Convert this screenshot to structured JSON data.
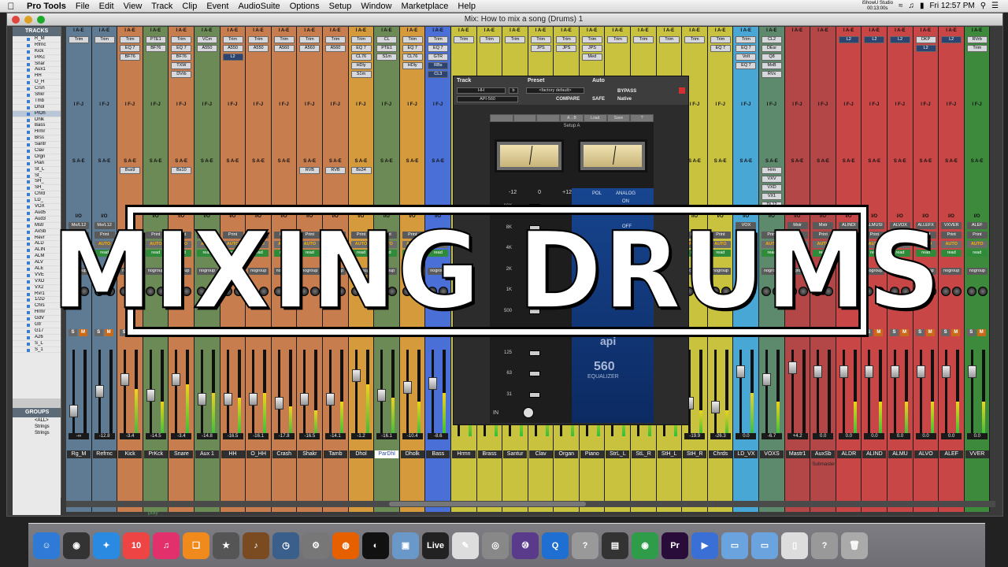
{
  "menubar": {
    "apple": "",
    "items": [
      "Pro Tools",
      "File",
      "Edit",
      "View",
      "Track",
      "Clip",
      "Event",
      "AudioSuite",
      "Options",
      "Setup",
      "Window",
      "Marketplace",
      "Help"
    ],
    "studio_line1": "iShowU Studio",
    "studio_line2": "00:13:00s",
    "clock": "Fri 12:57 PM"
  },
  "window": {
    "title": "Mix: How to mix a song (Drums) 1"
  },
  "leftpanel": {
    "tracks_header": "TRACKS",
    "tracks": [
      "R_M",
      "Rfrnc",
      "Kick",
      "PrKc",
      "Snar",
      "Aux1",
      "HH",
      "O_H",
      "Crsh",
      "Shkr",
      "Tmb",
      "Dhol",
      "PrDh",
      "Dhlk",
      "Bass",
      "Hrmr",
      "Brss",
      "Santr",
      "Clav",
      "Orgn",
      "Pian",
      "St_L",
      "St_",
      "SH_",
      "SH_",
      "Chrd",
      "LD_",
      "VOX",
      "Aud5",
      "Aud3",
      "Mstr",
      "AxSb",
      "Revr",
      "ALD",
      "ALIN",
      "ALM",
      "ALV",
      "ALE",
      "VVE",
      "VXD",
      "VX2",
      "Rvr1",
      "1/2D",
      "Chrs",
      "Hrmr",
      "GdV",
      "Gtr",
      "G17",
      "A26",
      "S_L",
      "S_1"
    ],
    "groups_header": "GROUPS",
    "groups": [
      "<ALL>",
      "Strings",
      "Strings"
    ]
  },
  "strips": [
    {
      "name": "Rg_M",
      "color": "#5f7b93",
      "vol": "-∞",
      "plugs": [
        "Trim"
      ],
      "io": "Mo/L12",
      "sends": [],
      "fader": 0.3,
      "meter": 0.0
    },
    {
      "name": "Refrnc",
      "color": "#5f7b93",
      "vol": "-12.8",
      "plugs": [
        "Trim"
      ],
      "io": "Mo/L12",
      "sends": [],
      "fader": 0.55,
      "meter": 0.0
    },
    {
      "name": "Kick",
      "color": "#c87d4f",
      "vol": "-3.4",
      "plugs": [
        "Trim",
        "EQ 7",
        "BF76"
      ],
      "io": "",
      "sends": [
        "Bus9"
      ],
      "fader": 0.7,
      "meter": 0.55
    },
    {
      "name": "PrKck",
      "color": "#6b8a55",
      "vol": "-14.5",
      "plugs": [
        "PTE1",
        "BF76"
      ],
      "io": "",
      "sends": [],
      "fader": 0.5,
      "meter": 0.4
    },
    {
      "name": "Snare",
      "color": "#c87d4f",
      "vol": "-3.4",
      "plugs": [
        "Trim",
        "EQ 7",
        "BF76",
        "TXW",
        "DVrb"
      ],
      "io": "",
      "sends": [
        "Bs10"
      ],
      "fader": 0.7,
      "meter": 0.6
    },
    {
      "name": "Aux 1",
      "color": "#6b8a55",
      "vol": "-14.8",
      "plugs": [
        "VCm",
        "A550"
      ],
      "io": "",
      "sends": [],
      "fader": 0.45,
      "meter": 0.5
    },
    {
      "name": "HH",
      "color": "#c87d4f",
      "vol": "-16.5",
      "plugs": [
        "Trim",
        "A550",
        "L2"
      ],
      "io": "",
      "sends": [],
      "fader": 0.45,
      "meter": 0.45
    },
    {
      "name": "O_HH",
      "color": "#c87d4f",
      "vol": "-16.1",
      "plugs": [
        "Trim",
        "A550"
      ],
      "io": "",
      "sends": [],
      "fader": 0.45,
      "meter": 0.5
    },
    {
      "name": "Crash",
      "color": "#c87d4f",
      "vol": "-17.8",
      "plugs": [
        "Trim",
        "A560"
      ],
      "io": "",
      "sends": [],
      "fader": 0.4,
      "meter": 0.35
    },
    {
      "name": "Shakr",
      "color": "#c87d4f",
      "vol": "-16.5",
      "plugs": [
        "Trim",
        "A560"
      ],
      "io": "",
      "sends": [
        "RVB"
      ],
      "fader": 0.45,
      "meter": 0.3
    },
    {
      "name": "Tamb",
      "color": "#c87d4f",
      "vol": "-14.1",
      "plugs": [
        "Trim",
        "A560"
      ],
      "io": "",
      "sends": [
        "RVB"
      ],
      "fader": 0.45,
      "meter": 0.4
    },
    {
      "name": "Dhol",
      "color": "#d49a3c",
      "vol": "-1.2",
      "plugs": [
        "Trim",
        "EQ 7",
        "CL76",
        "HDly",
        "S1m"
      ],
      "io": "",
      "sends": [
        "Bs34"
      ],
      "fader": 0.75,
      "meter": 0.6
    },
    {
      "name": "ParDhl",
      "color": "#6b8a55",
      "vol": "-16.1",
      "plugs": [
        "CL",
        "PTE1",
        "S1m"
      ],
      "io": "",
      "sends": [],
      "fader": 0.5,
      "meter": 0.45,
      "selected": true
    },
    {
      "name": "Dholk",
      "color": "#d49a3c",
      "vol": "-10.4",
      "plugs": [
        "Trim",
        "EQ 7",
        "CL76",
        "HDly"
      ],
      "io": "",
      "sends": [],
      "fader": 0.6,
      "meter": 0.4
    },
    {
      "name": "Bass",
      "color": "#4a6fd6",
      "vol": "-8.6",
      "plugs": [
        "Trim",
        "EQ 7",
        "GTR",
        "RBs",
        "CL3"
      ],
      "io": "",
      "sends": [],
      "fader": 0.65,
      "meter": 0.5
    },
    {
      "name": "Hrmn",
      "color": "#c9c23f",
      "vol": "",
      "plugs": [
        "Trim"
      ],
      "io": "",
      "sends": [],
      "fader": 0.5,
      "meter": 0.3
    },
    {
      "name": "Brass",
      "color": "#c9c23f",
      "vol": "",
      "plugs": [
        "Trim"
      ],
      "io": "",
      "sends": [],
      "fader": 0.5,
      "meter": 0.3
    },
    {
      "name": "Santur",
      "color": "#c9c23f",
      "vol": "",
      "plugs": [
        "Trim"
      ],
      "io": "",
      "sends": [],
      "fader": 0.5,
      "meter": 0.3
    },
    {
      "name": "Clav",
      "color": "#c9c23f",
      "vol": "",
      "plugs": [
        "Trim",
        "JPS"
      ],
      "io": "",
      "sends": [],
      "fader": 0.5,
      "meter": 0.3
    },
    {
      "name": "Organ",
      "color": "#c9c23f",
      "vol": "",
      "plugs": [
        "Trim",
        "JPS"
      ],
      "io": "",
      "sends": [],
      "fader": 0.5,
      "meter": 0.3
    },
    {
      "name": "Piano",
      "color": "#c9c23f",
      "vol": "",
      "plugs": [
        "Trim",
        "JPS",
        "Med"
      ],
      "io": "",
      "sends": [],
      "fader": 0.5,
      "meter": 0.3
    },
    {
      "name": "StrL_L",
      "color": "#c9c23f",
      "vol": "",
      "plugs": [
        "Trim"
      ],
      "io": "",
      "sends": [],
      "fader": 0.5,
      "meter": 0.3
    },
    {
      "name": "StL_R",
      "color": "#c9c23f",
      "vol": "",
      "plugs": [
        "Trim"
      ],
      "io": "",
      "sends": [],
      "fader": 0.5,
      "meter": 0.3
    },
    {
      "name": "StH_L",
      "color": "#c9c23f",
      "vol": "",
      "plugs": [
        "Trim"
      ],
      "io": "",
      "sends": [],
      "fader": 0.5,
      "meter": 0.3
    },
    {
      "name": "StH_R",
      "color": "#c9c23f",
      "vol": "-19.9",
      "plugs": [
        "Trim"
      ],
      "io": "",
      "sends": [],
      "fader": 0.4,
      "meter": 0.3
    },
    {
      "name": "Chrds",
      "color": "#c9c23f",
      "vol": "-26.3",
      "plugs": [
        "Trim",
        "EQ 7"
      ],
      "io": "",
      "sends": [],
      "fader": 0.35,
      "meter": 0.3
    },
    {
      "name": "LD_VX",
      "color": "#49a7d6",
      "vol": "0.0",
      "plugs": [
        "Trim",
        "EQ 7",
        "VoIt",
        "EQ 7"
      ],
      "io": "VOX",
      "sends": [],
      "fader": 0.8,
      "meter": 0.5
    },
    {
      "name": "VOXS",
      "color": "#5d8a6c",
      "vol": "-6.7",
      "plugs": [
        "CL2",
        "DEsr",
        "Q8",
        "MxB",
        "RVx"
      ],
      "io": "",
      "sends": [
        "Hrm",
        "VXV",
        "VXD",
        "VX1",
        "DL12"
      ],
      "fader": 0.7,
      "meter": 0.4
    },
    {
      "name": "Mastr1",
      "color": "#b34747",
      "vol": "+4.2",
      "plugs": [],
      "io": "Mstr",
      "sends": [],
      "fader": 0.85,
      "meter": 0.0
    },
    {
      "name": "AuxSb",
      "color": "#b34747",
      "vol": "0.0",
      "plugs": [],
      "io": "Mstr",
      "sends": [],
      "fader": 0.8,
      "meter": 0.0,
      "comment": "Submaster"
    },
    {
      "name": "ALDR",
      "color": "#c94646",
      "vol": "0.0",
      "plugs": [
        "L2"
      ],
      "io": "ALINDI",
      "sends": [],
      "fader": 0.8,
      "meter": 0.4
    },
    {
      "name": "ALIND",
      "color": "#c94646",
      "vol": "0.0",
      "plugs": [
        "L2"
      ],
      "io": "ALMUSI",
      "sends": [],
      "fader": 0.8,
      "meter": 0.4
    },
    {
      "name": "ALMU",
      "color": "#c94646",
      "vol": "0.0",
      "plugs": [
        "L2"
      ],
      "io": "ALVOX",
      "sends": [],
      "fader": 0.8,
      "meter": 0.4
    },
    {
      "name": "ALVO",
      "color": "#c94646",
      "vol": "0.0",
      "plugs": [
        "DKP",
        "L2"
      ],
      "io": "ALLEFX",
      "sends": [],
      "fader": 0.8,
      "meter": 0.4
    },
    {
      "name": "ALEF",
      "color": "#c94646",
      "vol": "0.0",
      "plugs": [
        "L2"
      ],
      "io": "VXVER",
      "sends": [],
      "fader": 0.8,
      "meter": 0.4
    },
    {
      "name": "VVER",
      "color": "#3d8a3d",
      "vol": "0.0",
      "plugs": [
        "RVrb",
        "Trim"
      ],
      "io": "ALEF",
      "sends": [],
      "fader": 0.8,
      "meter": 0.4
    }
  ],
  "strip_labels": {
    "inserts_header": "I A-E",
    "inserts_b_header": "I F-J",
    "sends_header": "S A-E",
    "io_header": "I/O",
    "auto_label": "AUTO",
    "read_label": "read",
    "nogroup_label": "nogroup",
    "print_label": "Print",
    "solo_label": "S",
    "mute_label": "M"
  },
  "plugin": {
    "track_label": "Track",
    "preset_label": "Preset",
    "auto_label": "Auto",
    "track_name": "HH",
    "track_b": "b",
    "preset_name": "<factory default>",
    "plugin_name": "API-560",
    "compare_label": "COMPARE",
    "safe_label": "SAFE",
    "bypass_label": "BYPASS",
    "native_label": "Native",
    "toolbar": [
      "",
      "",
      "",
      "A→B",
      "Load",
      "Save",
      "?"
    ],
    "setup_label": "Setup A",
    "scale_top": [
      "-12",
      "0",
      "+12"
    ],
    "freqs": [
      "16K",
      "8K",
      "4K",
      "2K",
      "1K",
      "500",
      "250",
      "125",
      "63",
      "31"
    ],
    "pol_label": "POL",
    "analog_label": "ANALOG",
    "on_label": "ON",
    "off_label": "OFF",
    "in_label": "IN",
    "brand": "api",
    "model": "560",
    "model_sub": "EQUALIZER"
  },
  "banner": {
    "text": "MIXING DRUMS"
  },
  "statusbar": {
    "text": "play"
  },
  "dock": {
    "icons": [
      {
        "name": "finder-icon",
        "color": "#2e7ad6",
        "glyph": "☺"
      },
      {
        "name": "dashboard-icon",
        "color": "#333",
        "glyph": "◉"
      },
      {
        "name": "safari-icon",
        "color": "#2a89e0",
        "glyph": "✦"
      },
      {
        "name": "calendar-icon",
        "color": "#e44",
        "glyph": "10"
      },
      {
        "name": "itunes-icon",
        "color": "#e2306c",
        "glyph": "♫"
      },
      {
        "name": "ibooks-icon",
        "color": "#f08a1c",
        "glyph": "❑"
      },
      {
        "name": "star-icon",
        "color": "#555",
        "glyph": "★"
      },
      {
        "name": "guitar-icon",
        "color": "#7a4a20",
        "glyph": "♪"
      },
      {
        "name": "time-machine-icon",
        "color": "#3a5f8a",
        "glyph": "◷"
      },
      {
        "name": "system-prefs-icon",
        "color": "#777",
        "glyph": "⚙"
      },
      {
        "name": "firefox-icon",
        "color": "#e66000",
        "glyph": "◍"
      },
      {
        "name": "logic-icon",
        "color": "#111",
        "glyph": "◐"
      },
      {
        "name": "preview-icon",
        "color": "#6a98c9",
        "glyph": "▣"
      },
      {
        "name": "live-icon",
        "color": "#222",
        "glyph": "Live"
      },
      {
        "name": "textedit-icon",
        "color": "#ddd",
        "glyph": "✎"
      },
      {
        "name": "disk-utility-icon",
        "color": "#888",
        "glyph": "◎"
      },
      {
        "name": "pro-tools-icon",
        "color": "#5a3a8a",
        "glyph": "⑩"
      },
      {
        "name": "quicktime-icon",
        "color": "#1e6fd1",
        "glyph": "Q"
      },
      {
        "name": "help-icon",
        "color": "#999",
        "glyph": "?"
      },
      {
        "name": "finalcut-icon",
        "color": "#333",
        "glyph": "▤"
      },
      {
        "name": "chrome-icon",
        "color": "#2f9c4a",
        "glyph": "◉"
      },
      {
        "name": "premiere-icon",
        "color": "#2a0c3a",
        "glyph": "Pr"
      },
      {
        "name": "screenflow-icon",
        "color": "#3a6fd6",
        "glyph": "▶"
      },
      {
        "name": "folder-icon",
        "color": "#6aa3de",
        "glyph": "▭"
      },
      {
        "name": "documents-icon",
        "color": "#6aa3de",
        "glyph": "▭"
      },
      {
        "name": "file-icon",
        "color": "#ddd",
        "glyph": "▯"
      },
      {
        "name": "help2-icon",
        "color": "#999",
        "glyph": "?"
      },
      {
        "name": "trash-icon",
        "color": "#aaa",
        "glyph": "🗑"
      }
    ]
  }
}
